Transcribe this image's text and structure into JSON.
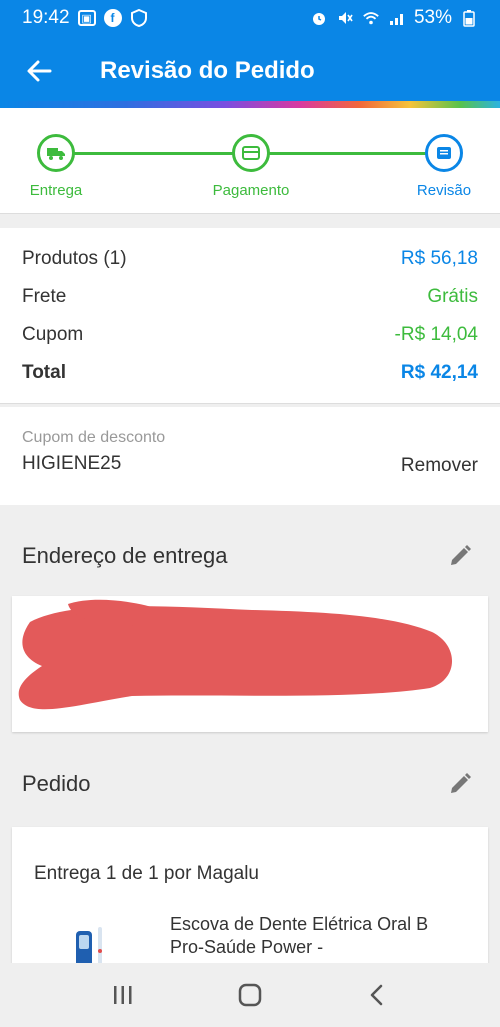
{
  "status_bar": {
    "time": "19:42",
    "battery": "53%",
    "left_icons": [
      "gallery-icon",
      "facebook-icon",
      "shield-icon"
    ],
    "right_icons": [
      "alarm-icon",
      "mute-icon",
      "wifi-icon",
      "signal-icon",
      "battery-icon"
    ]
  },
  "header": {
    "title": "Revisão do Pedido"
  },
  "stepper": {
    "steps": [
      {
        "label": "Entrega",
        "icon": "truck-icon",
        "state": "done"
      },
      {
        "label": "Pagamento",
        "icon": "card-icon",
        "state": "done"
      },
      {
        "label": "Revisão",
        "icon": "review-icon",
        "state": "active"
      }
    ]
  },
  "summary": {
    "products_label": "Produtos (1)",
    "products_value": "R$ 56,18",
    "shipping_label": "Frete",
    "shipping_value": "Grátis",
    "coupon_label": "Cupom",
    "coupon_value": "-R$ 14,04",
    "total_label": "Total",
    "total_value": "R$ 42,14"
  },
  "coupon": {
    "label": "Cupom de desconto",
    "code": "HIGIENE25",
    "remove_label": "Remover"
  },
  "address": {
    "title": "Endereço de entrega"
  },
  "order": {
    "title": "Pedido",
    "delivery_title": "Entrega 1 de 1 por Magalu",
    "product_name": "Escova de Dente Elétrica Oral B Pro-Saúde Power -"
  },
  "colors": {
    "primary": "#0a86e6",
    "green": "#3dbb3d",
    "redaction": "#e35a5a"
  }
}
